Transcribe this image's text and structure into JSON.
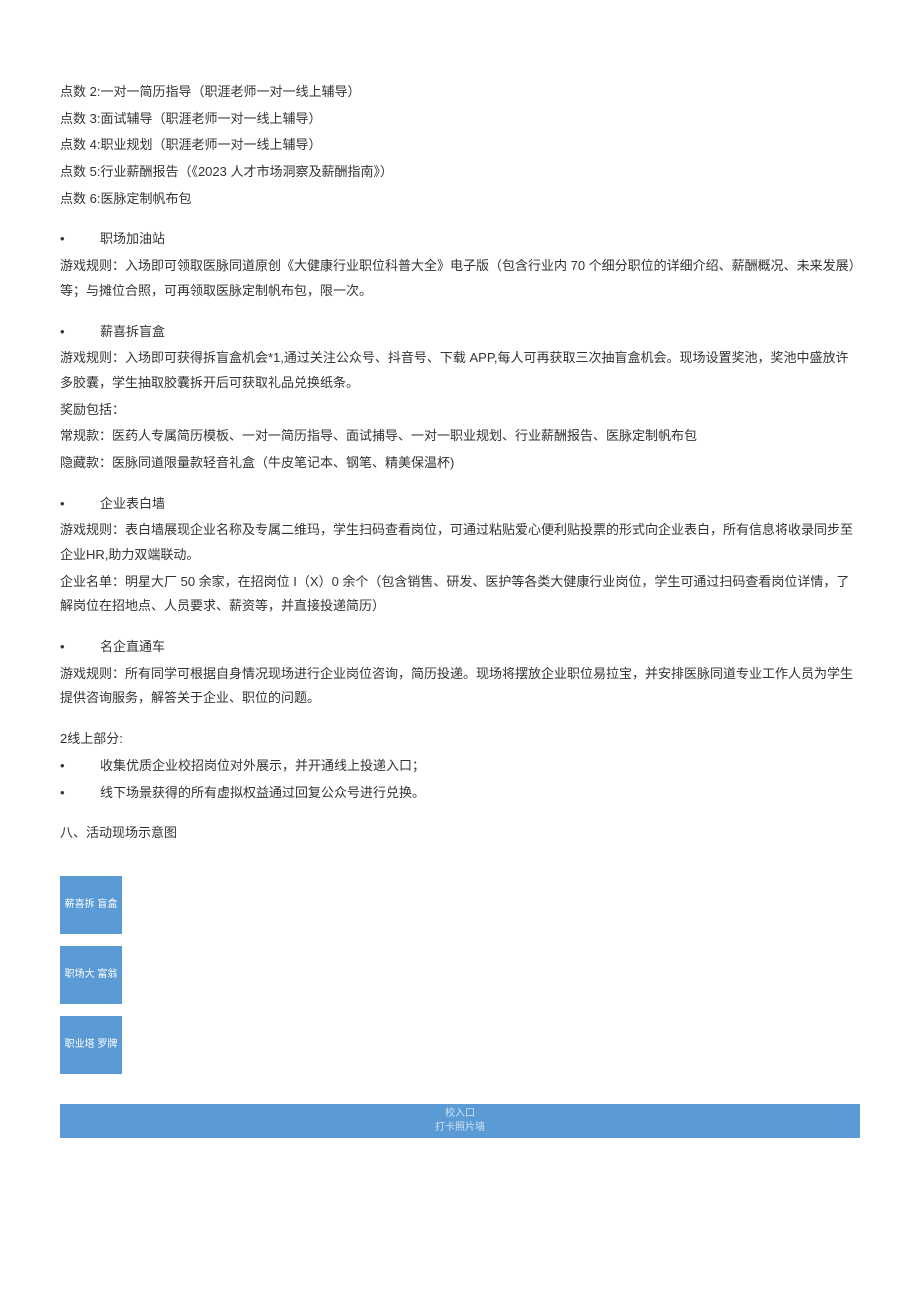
{
  "points": {
    "p2": "点数 2:一对一简历指导（职涯老师一对一线上辅导）",
    "p3": "点数 3:面试辅导（职涯老师一对一线上辅导）",
    "p4": "点数 4:职业规划（职涯老师一对一线上辅导）",
    "p5": "点数 5:行业薪酬报告（《2023 人才市场洞察及薪酬指南》）",
    "p6": "点数 6:医脉定制帆布包"
  },
  "sections": {
    "zjz": {
      "title": "职场加油站",
      "rule": "游戏规则：入场即可领取医脉同道原创《大健康行业职位科普大全》电子版（包含行业内 70 个细分职位的详细介绍、薪酬概况、未来发展）等；与摊位合照，可再领取医脉定制帆布包，限一次。"
    },
    "xxcmh": {
      "title": "薪喜拆盲盒",
      "rule": "游戏规则：入场即可获得拆盲盒机会*1,通过关注公众号、抖音号、下载 APP,每人可再获取三次抽盲盒机会。现场设置奖池，奖池中盛放许多胶囊，学生抽取胶囊拆开后可获取礼品兑换纸条。",
      "reward_label": "奖励包括：",
      "normal": "常规款：医药人专属简历模板、一对一简历指导、面试捕导、一对一职业规划、行业薪酬报告、医脉定制帆布包",
      "hidden": "隐藏款：医脉同道限量款轻音礼盒（牛皮笔记本、钢笔、精美保温杯)"
    },
    "qybbq": {
      "title": "企业表白墙",
      "rule": "游戏规则：表白墙展现企业名称及专属二维玛，学生扫码查看岗位，可通过粘贴爱心便利贴投票的形式向企业表白，所有信息将收录同步至企业HR,助力双端联动。",
      "list": "企业名单：明星大厂 50 余家，在招岗位 I（X）0 余个（包含销售、研发、医护等各类大健康行业岗位，学生可通过扫码查看岗位详情，了解岗位在招地点、人员要求、薪资等，并直接投递简历）"
    },
    "mqztc": {
      "title": "名企直通车",
      "rule": "游戏规则：所有同学可根据自身情况现场进行企业岗位咨询，简历投递。现场将摆放企业职位易拉宝，并安排医脉同道专业工作人员为学生提供咨询服务，解答关于企业、职位的问题。"
    },
    "online": {
      "title": "2线上部分:",
      "item1": "收集优质企业校招岗位对外展示，并开通线上投递入口；",
      "item2": "线下场景获得的所有虚拟权益通过回复公众号进行兑换。"
    },
    "diagram_title": "八、活动现场示意图"
  },
  "diagram": {
    "box1": "薪喜拆\n盲盒",
    "box2": "职场大\n富翁",
    "box3": "职业塔\n罗牌",
    "banner_line1": "校入口",
    "banner_line2": "打卡照片墙"
  }
}
